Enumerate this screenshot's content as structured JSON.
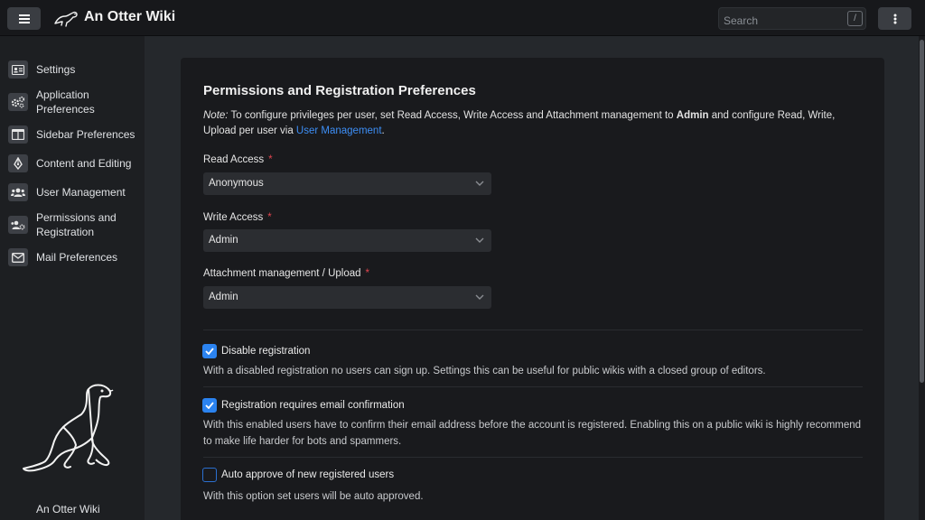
{
  "app": {
    "title": "An Otter Wiki"
  },
  "search": {
    "placeholder": "Search",
    "shortcut": "/"
  },
  "sidebar": {
    "items": [
      {
        "label": "Settings",
        "icon": "id-card-icon"
      },
      {
        "label": "Application\nPreferences",
        "icon": "gears-icon"
      },
      {
        "label": "Sidebar Preferences",
        "icon": "columns-icon"
      },
      {
        "label": "Content and Editing",
        "icon": "pen-nib-icon"
      },
      {
        "label": "User Management",
        "icon": "users-icon"
      },
      {
        "label": "Permissions and\nRegistration",
        "icon": "users-gear-icon"
      },
      {
        "label": "Mail Preferences",
        "icon": "envelope-icon"
      }
    ],
    "footer": "An Otter Wiki"
  },
  "main": {
    "title": "Permissions and Registration Preferences",
    "note_prefix": "Note:",
    "note_text_1": " To configure privileges per user, set Read Access, Write Access and Attachment management to ",
    "note_bold": "Admin",
    "note_text_2": " and configure Read, Write, Upload per user via ",
    "note_link": "User Management",
    "note_end": ".",
    "fields": [
      {
        "label": "Read Access",
        "value": "Anonymous",
        "required": "*"
      },
      {
        "label": "Write Access",
        "value": "Admin",
        "required": "*"
      },
      {
        "label": "Attachment management / Upload",
        "value": "Admin",
        "required": "*"
      }
    ],
    "checkboxes": [
      {
        "label": "Disable registration",
        "checked": true,
        "help": "With a disabled registration no users can sign up. Settings this can be useful for public wikis with a closed group of editors."
      },
      {
        "label": "Registration requires email confirmation",
        "checked": true,
        "help": "With this enabled users have to confirm their email address before the account is registered. Enabling this on a public wiki is highly recommend to make life harder for bots and spammers."
      },
      {
        "label": "Auto approve of new registered users",
        "checked": false,
        "help": "With this option set users will be auto approved."
      }
    ]
  },
  "colors": {
    "accent": "#2b83f0",
    "link": "#3d8ef5",
    "required": "#e0454f"
  }
}
